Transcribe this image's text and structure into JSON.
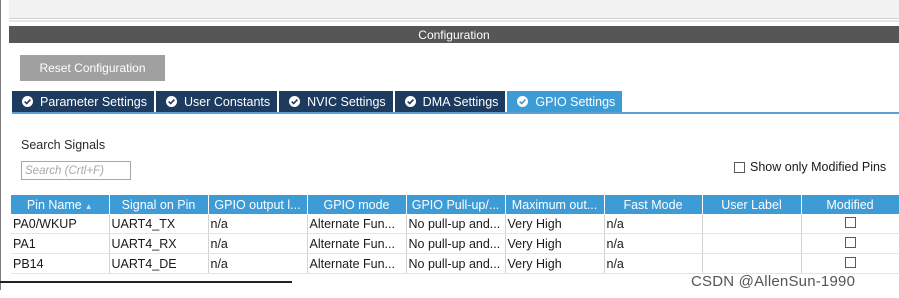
{
  "header": {
    "title": "Configuration"
  },
  "actions": {
    "reset_label": "Reset Configuration"
  },
  "tabs": [
    {
      "label": "Parameter Settings",
      "active": false
    },
    {
      "label": "User Constants",
      "active": false
    },
    {
      "label": "NVIC Settings",
      "active": false
    },
    {
      "label": "DMA Settings",
      "active": false
    },
    {
      "label": "GPIO Settings",
      "active": true
    }
  ],
  "search": {
    "label": "Search Signals",
    "placeholder": "Search (Crtl+F)",
    "value": ""
  },
  "filter": {
    "modified_only_label": "Show only Modified Pins",
    "checked": false
  },
  "table": {
    "columns": [
      "Pin Name",
      "Signal on Pin",
      "GPIO output l...",
      "GPIO mode",
      "GPIO Pull-up/...",
      "Maximum out...",
      "Fast Mode",
      "User Label",
      "Modified"
    ],
    "sorted_column": "Pin Name",
    "rows": [
      [
        "PA0/WKUP",
        "UART4_TX",
        "n/a",
        "Alternate Fun...",
        "No pull-up and...",
        "Very High",
        "n/a",
        "",
        false
      ],
      [
        "PA1",
        "UART4_RX",
        "n/a",
        "Alternate Fun...",
        "No pull-up and...",
        "Very High",
        "n/a",
        "",
        false
      ],
      [
        "PB14",
        "UART4_DE",
        "n/a",
        "Alternate Fun...",
        "No pull-up and...",
        "Very High",
        "n/a",
        "",
        false
      ]
    ]
  },
  "watermark": "CSDN @AllenSun-1990",
  "colors": {
    "header_bar": "#565656",
    "tab_inactive": "#1d3a5f",
    "tab_active": "#3d9bd6",
    "table_header": "#3d9bd6",
    "button": "#a0a0a0"
  },
  "icons": {
    "tab_status": "check-circle-icon",
    "sort": "sort-ascending-icon"
  }
}
